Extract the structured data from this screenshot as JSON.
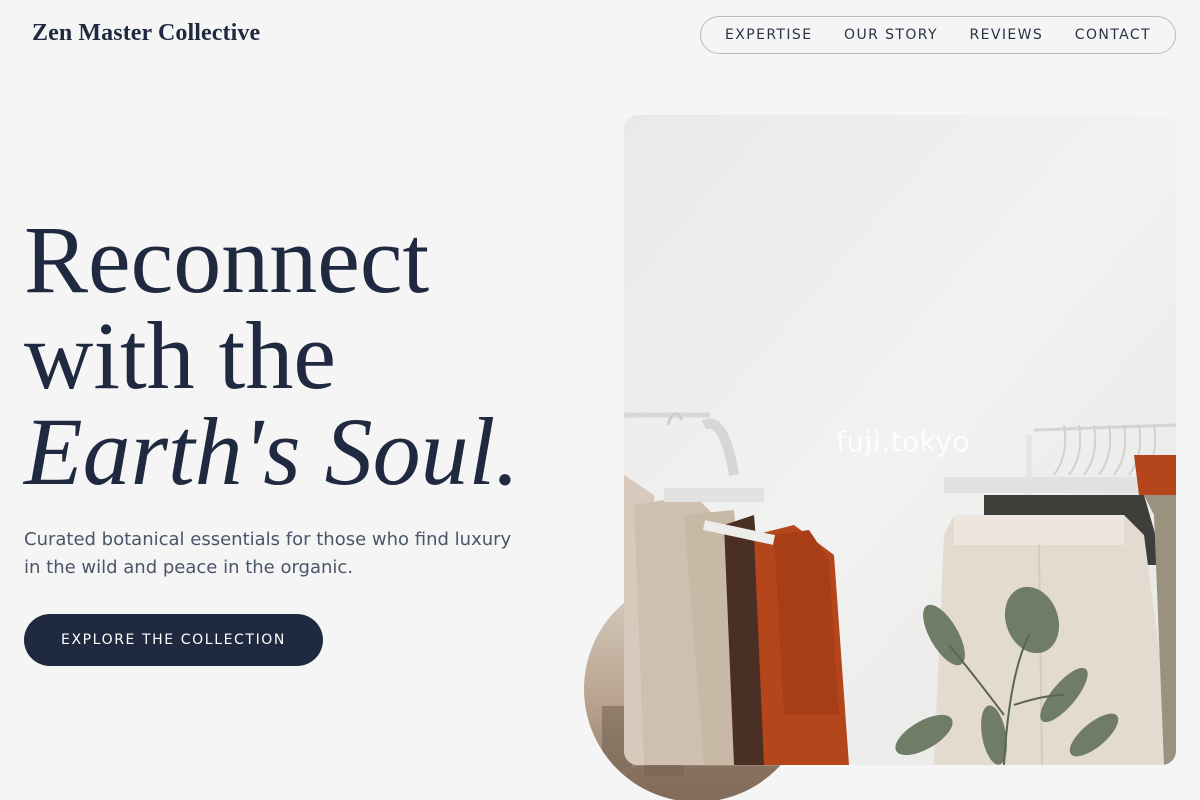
{
  "header": {
    "brand": "Zen Master Collective",
    "nav": [
      {
        "label": "EXPERTISE"
      },
      {
        "label": "OUR STORY"
      },
      {
        "label": "REVIEWS"
      },
      {
        "label": "CONTACT"
      }
    ]
  },
  "hero": {
    "headline_line1": "Reconnect",
    "headline_line2": "with the",
    "headline_line3": "Earth's Soul.",
    "subtitle": "Curated botanical essentials for those who find luxury in the wild and peace in the organic.",
    "cta_label": "EXPLORE THE COLLECTION"
  },
  "image": {
    "watermark": "fuji.tokyo"
  },
  "colors": {
    "background": "#f5f5f5",
    "primary": "#1f2a40",
    "muted_text": "#4b5569",
    "rust": "#b5461c",
    "sage": "#6f7c66"
  }
}
